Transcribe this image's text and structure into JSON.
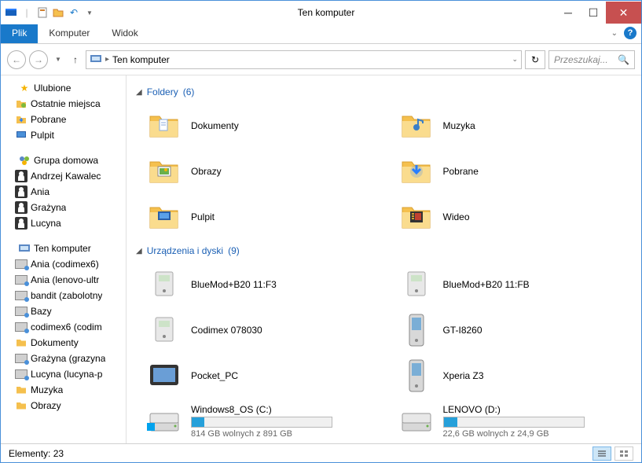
{
  "window_title": "Ten komputer",
  "ribbon": {
    "file": "Plik",
    "tabs": [
      "Komputer",
      "Widok"
    ]
  },
  "nav": {
    "address_location": "Ten komputer",
    "search_placeholder": "Przeszukaj..."
  },
  "sidebar": {
    "favorites": {
      "label": "Ulubione",
      "items": [
        "Ostatnie miejsca",
        "Pobrane",
        "Pulpit"
      ]
    },
    "homegroup": {
      "label": "Grupa domowa",
      "items": [
        "Andrzej Kawalec",
        "Ania",
        "Grażyna",
        "Lucyna"
      ]
    },
    "computer": {
      "label": "Ten komputer",
      "items": [
        "Ania (codimex6)",
        "Ania (lenovo-ultr",
        "bandit (zabolotny",
        "Bazy",
        "codimex6 (codim",
        "Dokumenty",
        "Grażyna (grazyna",
        "Lucyna (lucyna-p",
        "Muzyka",
        "Obrazy"
      ]
    }
  },
  "sections": {
    "folders": {
      "label": "Foldery",
      "count": "(6)"
    },
    "devices": {
      "label": "Urządzenia i dyski",
      "count": "(9)"
    }
  },
  "folders": [
    {
      "name": "Dokumenty",
      "icon": "doc"
    },
    {
      "name": "Muzyka",
      "icon": "music"
    },
    {
      "name": "Obrazy",
      "icon": "image"
    },
    {
      "name": "Pobrane",
      "icon": "download"
    },
    {
      "name": "Pulpit",
      "icon": "desktop"
    },
    {
      "name": "Wideo",
      "icon": "video"
    }
  ],
  "devices": [
    {
      "name": "BlueMod+B20 11:F3",
      "type": "device"
    },
    {
      "name": "BlueMod+B20 11:FB",
      "type": "device"
    },
    {
      "name": "Codimex 078030",
      "type": "device"
    },
    {
      "name": "GT-I8260",
      "type": "phone"
    },
    {
      "name": "Pocket_PC",
      "type": "pda"
    },
    {
      "name": "Xperia Z3",
      "type": "phone"
    }
  ],
  "drives": [
    {
      "name": "Windows8_OS (C:)",
      "sub": "814 GB wolnych z 891 GB",
      "fill": 9
    },
    {
      "name": "LENOVO (D:)",
      "sub": "22,6 GB wolnych z 24,9 GB",
      "fill": 10
    }
  ],
  "status": {
    "items": "Elementy: 23"
  }
}
